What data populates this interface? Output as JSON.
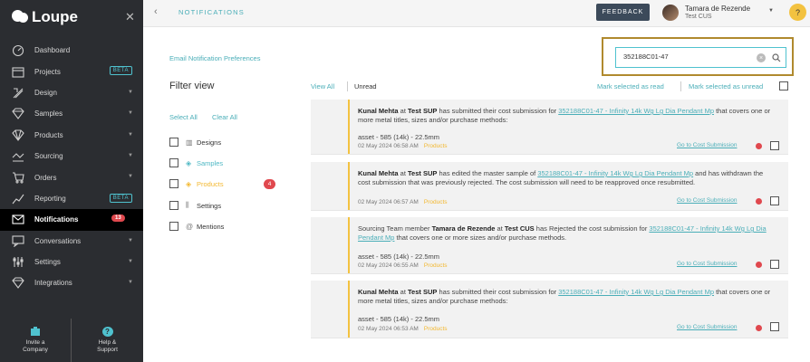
{
  "app": {
    "name": "Loupe"
  },
  "sidebar": {
    "items": [
      {
        "label": "Dashboard",
        "icon": "dashboard-icon"
      },
      {
        "label": "Projects",
        "icon": "projects-icon",
        "badge": "BETA"
      },
      {
        "label": "Design",
        "icon": "design-icon",
        "has_caret": true
      },
      {
        "label": "Samples",
        "icon": "samples-icon",
        "has_caret": true
      },
      {
        "label": "Products",
        "icon": "products-icon",
        "has_caret": true
      },
      {
        "label": "Sourcing",
        "icon": "sourcing-icon",
        "has_caret": true
      },
      {
        "label": "Orders",
        "icon": "orders-icon",
        "has_caret": true
      },
      {
        "label": "Reporting",
        "icon": "reporting-icon",
        "badge": "BETA"
      },
      {
        "label": "Notifications",
        "icon": "notifications-icon",
        "count": "13",
        "active": true
      },
      {
        "label": "Conversations",
        "icon": "conversations-icon",
        "has_caret": true
      },
      {
        "label": "Settings",
        "icon": "settings-icon",
        "has_caret": true
      },
      {
        "label": "Integrations",
        "icon": "integrations-icon",
        "has_caret": true
      }
    ],
    "bottom": {
      "invite_line1": "Invite a",
      "invite_line2": "Company",
      "help_line1": "Help &",
      "help_line2": "Support"
    }
  },
  "topbar": {
    "title": "NOTIFICATIONS",
    "feedback_label": "FEEDBACK",
    "user_name": "Tamara de Rezende",
    "user_org": "Test CUS",
    "help_label": "?"
  },
  "main": {
    "prefs_link": "Email Notification Preferences",
    "search": {
      "value": "352188C01-47"
    },
    "filter": {
      "title": "Filter view",
      "select_all": "Select All",
      "clear_all": "Clear All",
      "items": [
        {
          "label": "Designs"
        },
        {
          "label": "Samples"
        },
        {
          "label": "Products",
          "count": "4"
        },
        {
          "label": "Settings"
        },
        {
          "label": "Mentions"
        }
      ]
    },
    "views": {
      "view_all": "View All",
      "unread": "Unread"
    },
    "actions": {
      "mark_read": "Mark selected as read",
      "mark_unread": "Mark selected as unread"
    },
    "notifications": [
      {
        "actor": "Kunal Mehta",
        "at": " at ",
        "company": "Test SUP",
        "text": " has submitted their cost submission for ",
        "link": "352188C01-47 - Infinity 14k Wg Lg Dia Pendant Mp",
        "tail": " that covers one or more metal titles, sizes and/or purchase methods:",
        "asset": "asset - 585 (14k) - 22.5mm",
        "date": "02 May 2024 06:58 AM",
        "tag": "Products",
        "goto": "Go to Cost Submission"
      },
      {
        "actor": "Kunal Mehta",
        "at": " at ",
        "company": "Test SUP",
        "text": " has edited the master sample of ",
        "link": "352188C01-47 - Infinity 14k Wg Lg Dia Pendant Mp",
        "tail": " and has withdrawn the cost submission that was previously rejected. The cost submission will need to be reapproved once resubmitted.",
        "date": "02 May 2024 06:57 AM",
        "tag": "Products",
        "goto": "Go to Cost Submission"
      },
      {
        "prefix": "Sourcing Team member ",
        "actor": "Tamara de Rezende",
        "at": " at ",
        "company": "Test CUS",
        "text": " has Rejected the cost submission for ",
        "link": "352188C01-47 - Infinity 14k Wg Lg Dia Pendant Mp",
        "tail": " that covers one or more sizes and/or purchase methods.",
        "asset": "asset - 585 (14k) - 22.5mm",
        "date": "02 May 2024 06:55 AM",
        "tag": "Products",
        "goto": "Go to Cost Submission"
      },
      {
        "actor": "Kunal Mehta",
        "at": " at ",
        "company": "Test SUP",
        "text": " has submitted their cost submission for ",
        "link": "352188C01-47 - Infinity 14k Wg Lg Dia Pendant Mp",
        "tail": " that covers one or more metal titles, sizes and/or purchase methods:",
        "asset": "asset - 585 (14k) - 22.5mm",
        "date": "02 May 2024 06:53 AM",
        "tag": "Products",
        "goto": "Go to Cost Submission"
      }
    ]
  },
  "colors": {
    "accent": "#4aaeb8",
    "highlight": "#f3c240",
    "alert": "#e0484e",
    "sidebar": "#2b2d31"
  }
}
